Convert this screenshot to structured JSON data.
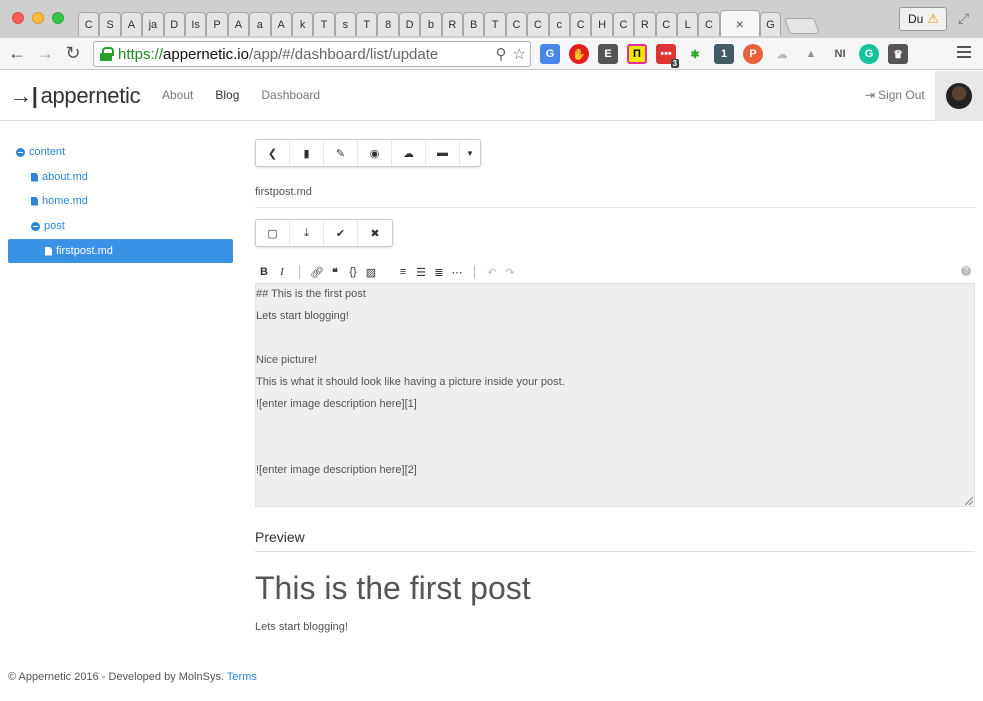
{
  "browser": {
    "tab_titles": [
      "C",
      "S",
      "A",
      "ja",
      "D",
      "Is",
      "P",
      "A",
      "a",
      "A",
      "k",
      "T",
      "s",
      "T",
      "8",
      "D",
      "b",
      "R",
      "B",
      "T",
      "C",
      "C",
      "c",
      "C",
      "H",
      "C",
      "R",
      "C",
      "L",
      "C"
    ],
    "active_tab_close": "×",
    "after_tab": "G",
    "profile_label": "Du",
    "url_scheme": "https://",
    "url_host": "appernetic.io",
    "url_path": "/app/#/dashboard/list/update",
    "extension_badge": "3"
  },
  "app": {
    "brand": "appernetic",
    "nav": [
      "About",
      "Blog",
      "Dashboard"
    ],
    "signout": "Sign Out"
  },
  "tree": {
    "root": "content",
    "files": [
      "about.md",
      "home.md"
    ],
    "folder": "post",
    "selected": "firstpost.md"
  },
  "editor": {
    "filename": "firstpost.md",
    "lines": [
      "## This is the first post",
      "Lets start blogging!",
      "",
      "Nice picture!",
      "This is what it should look like having a picture inside your post.",
      "![enter image description here][1]",
      "",
      "",
      "![enter image description here][2]"
    ]
  },
  "preview": {
    "heading": "Preview",
    "title": "This is the first post",
    "text": "Lets start blogging!"
  },
  "footer": {
    "text": "© Appernetic 2016 - Developed by MolnSys.",
    "link": "Terms"
  },
  "colors": {
    "link": "#2a87d8",
    "selected": "#3a92e6",
    "editor_bg": "#eeeeee"
  }
}
